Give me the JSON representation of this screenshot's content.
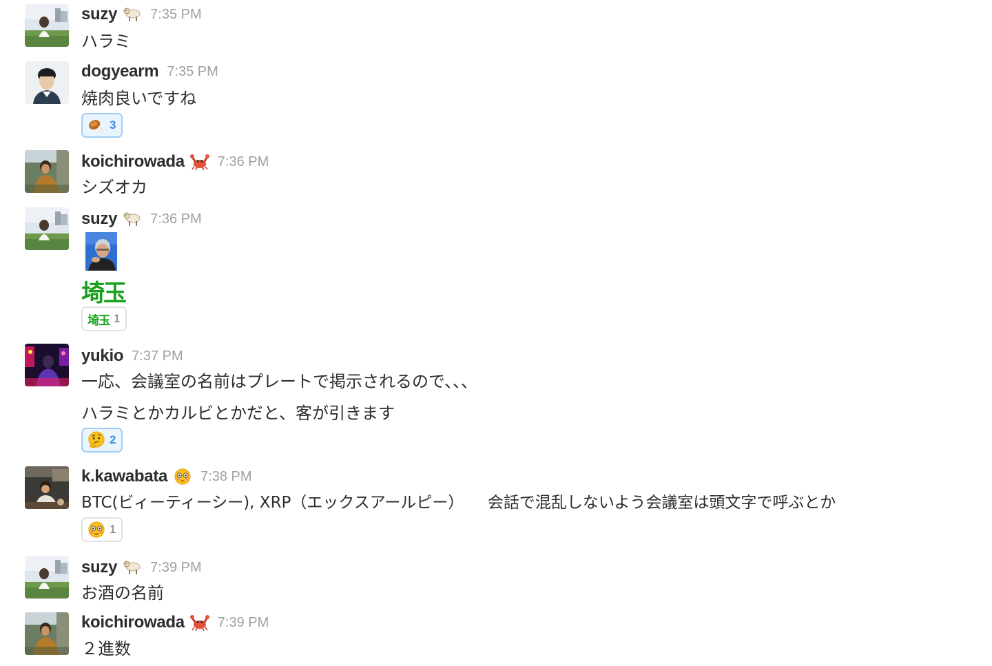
{
  "messages": [
    {
      "author": "suzy",
      "status_icon": "sheep-icon",
      "time": "7:35 PM",
      "text": "ハラミ"
    },
    {
      "author": "dogyearm",
      "time": "7:35 PM",
      "text": "焼肉良いですね",
      "reaction": {
        "icon": "meat-on-bone-icon",
        "count": "3"
      }
    },
    {
      "author": "koichirowada",
      "status_icon": "crab-icon",
      "time": "7:36 PM",
      "text": "シズオカ"
    },
    {
      "author": "suzy",
      "status_icon": "sheep-icon",
      "time": "7:36 PM",
      "custom_emoji_text": "埼玉",
      "reaction": {
        "icon": "saitama-emoji",
        "label": "埼玉",
        "count": "1"
      }
    },
    {
      "author": "yukio",
      "time": "7:37 PM",
      "text": "一応、会議室の名前はプレートで掲示されるので、、、",
      "text2": "ハラミとかカルビとかだと、客が引きます",
      "reaction": {
        "icon": "thinking-face-icon",
        "count": "2"
      }
    },
    {
      "author": "k.kawabata",
      "status_icon": "flushed-face-icon",
      "time": "7:38 PM",
      "text": "BTC(ビィーティーシー), XRP（エックスアールピー）　　会話で混乱しないよう会議室は頭文字で呼ぶとか",
      "reaction": {
        "icon": "flushed-face-icon",
        "count": "1"
      }
    },
    {
      "author": "suzy",
      "status_icon": "sheep-icon",
      "time": "7:39 PM",
      "text": "お酒の名前"
    },
    {
      "author": "koichirowada",
      "status_icon": "crab-icon",
      "time": "7:39 PM",
      "text": "２進数"
    }
  ],
  "colors": {
    "author": "#2c2d30",
    "timestamp": "#a0a0a2",
    "reaction_active_bg": "#eaf4fd",
    "reaction_active_border": "#9fcdf5",
    "reaction_count_active": "#3a8ee6",
    "saitama_green": "#18a01a"
  }
}
